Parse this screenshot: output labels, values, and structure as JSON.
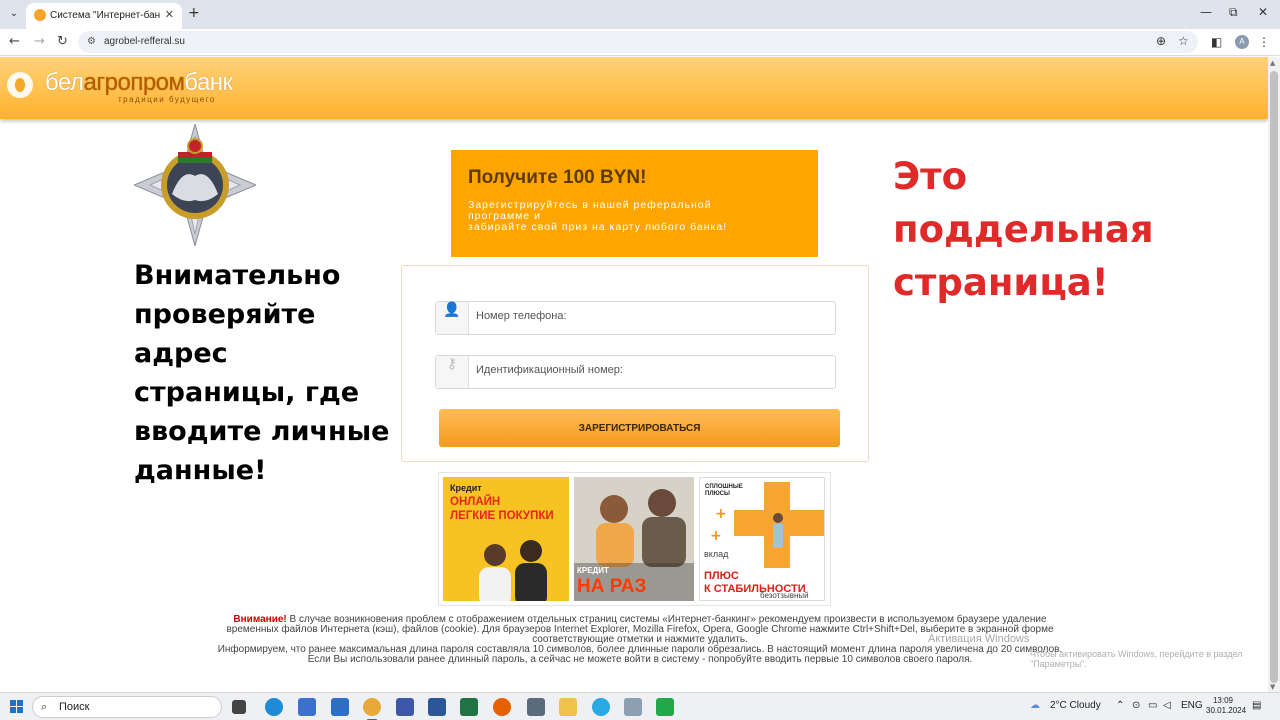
{
  "browser": {
    "tab_title": "Система \"Интернет-банкинг\"",
    "tab_close": "✕",
    "new_tab": "+",
    "url": "agrobel-refferal.su",
    "window_controls": [
      "—",
      "⧉",
      "✕"
    ]
  },
  "header": {
    "logo_part1": "бел",
    "logo_part2": "агропром",
    "logo_part3": "банк",
    "tagline": "традиции будущего"
  },
  "warnings": {
    "left": "Внимательно проверяйте адрес страницы, где вводите личные данные!",
    "right": "Это поддельная страница!"
  },
  "promo": {
    "title": "Получите 100 BYN!",
    "text_line1": "Зарегистрируйтесь в нашей реферальной программе и",
    "text_line2": "забирайте свой приз на карту любого банка!"
  },
  "form": {
    "phone_placeholder": "Номер телефона:",
    "id_placeholder": "Идентификационный номер:",
    "submit_label": "ЗАРЕГИСТРИРОВАТЬСЯ"
  },
  "banners": [
    {
      "small": "Кредит",
      "big_line1": "ОНЛАЙН",
      "big_line2": "ЛЕГКИЕ ПОКУПКИ"
    },
    {
      "small": "КРЕДИТ",
      "big": "НА РАЗ"
    },
    {
      "small_line1": "СПЛОШНЫЕ",
      "small_line2": "ПЛЮСЫ",
      "mid": "вклад",
      "big_line1": "ПЛЮС",
      "big_line2": "К СТАБИЛЬНОСТИ",
      "foot": "безотзывный"
    }
  ],
  "notice": {
    "label": "Внимание!",
    "paragraph1": "В случае возникновения проблем с отображением отдельных страниц системы «Интернет-банкинг» рекомендуем произвести в используемом браузере удаление временных файлов Интернета (кэш), файлов (cookie). Для браузеров Internet Explorer, Mozilla Firefox, Opera, Google Chrome нажмите Ctrl+Shift+Del, выберите в экранной форме соответствующие отметки и нажмите удалить.",
    "paragraph2": "Информируем, что ранее максимальная длина пароля составляла 10 символов, более длинные пароли обрезались. В настоящий момент длина пароля увеличена до 20 символов. Если Вы использовали ранее длинный пароль, а сейчас не можете войти в систему - попробуйте вводить первые 10 символов своего пароля."
  },
  "activation": {
    "title": "Активация Windows",
    "subtitle": "Чтобы активировать Windows, перейдите в раздел \"Параметры\"."
  },
  "taskbar": {
    "search_label": "Поиск",
    "weather": "2°C  Cloudy",
    "lang": "ENG",
    "time": "13:09",
    "date": "30.01.2024"
  },
  "colors": {
    "header_orange": "#ffb22c",
    "promo_orange": "#ffa500",
    "warning_red": "#e02a2a",
    "button_orange": "#f39b1c"
  }
}
